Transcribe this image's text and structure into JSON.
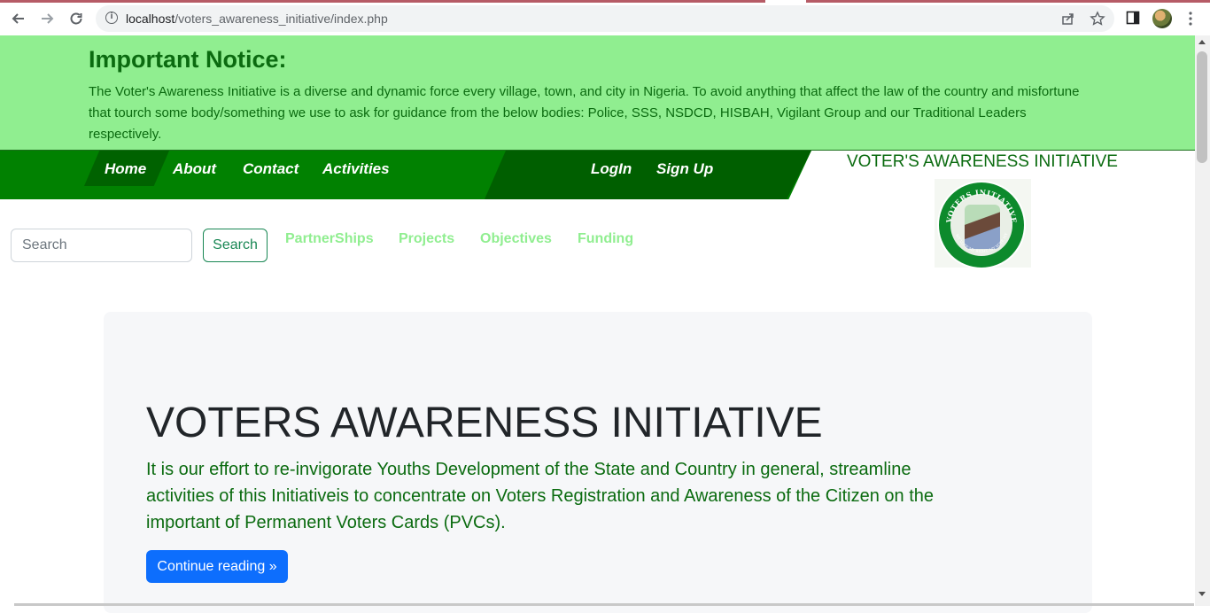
{
  "browser": {
    "url_host": "localhost",
    "url_path": "/voters_awareness_initiative/index.php"
  },
  "notice": {
    "title": "Important Notice:",
    "body": "The Voter's Awareness Initiative is a diverse and dynamic force every village, town, and city in Nigeria. To avoid anything that affect the law of the country and misfortune that tourch some body/something we use to ask for guidance from the below bodies: Police, SSS, NSDCD, HISBAH, Vigilant Group and our Traditional Leaders respectively."
  },
  "nav": {
    "home": "Home",
    "about": "About",
    "contact": "Contact",
    "activities": "Activities",
    "login": "LogIn",
    "signup": "Sign Up"
  },
  "brand": {
    "title": "VOTER'S AWARENESS INITIATIVE",
    "logo_text": "VOTERS INITIATIVE AWARENESS",
    "logo_motto": "MY VOTE MY RIGHT, MY VOTE MY POWER"
  },
  "search": {
    "placeholder": "Search",
    "button": "Search"
  },
  "subnav": {
    "partnerships": "PartnerShips",
    "projects": "Projects",
    "objectives": "Objectives",
    "funding": "Funding"
  },
  "hero": {
    "title": "VOTERS AWARENESS INITIATIVE",
    "body": "It is our effort to re-invigorate Youths Development of the State and Country in general, streamline activities of this Initiativeis to concentrate on Voters Registration and Awareness of the Citizen on the important of Permanent Voters Cards (PVCs).",
    "cta": "Continue reading »"
  },
  "colors": {
    "notice_bg": "#90ee90",
    "nav_green": "#018101",
    "dark_green_text": "#0b6b10",
    "primary_blue": "#0d6efd",
    "success_outline": "#198754"
  }
}
